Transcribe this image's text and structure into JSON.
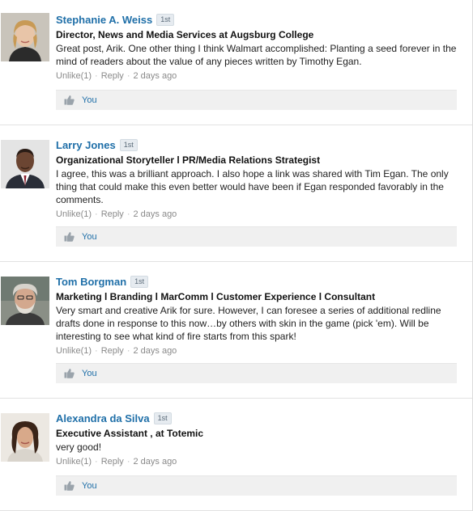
{
  "comments": [
    {
      "name": "Stephanie A. Weiss",
      "degree": "1st",
      "headline": "Director, News and Media Services at Augsburg College",
      "text": "Great post, Arik. One other thing I think Walmart accomplished: Planting a seed forever in the mind of readers about the value of any pieces written by Timothy Egan.",
      "unlike": "Unlike(1)",
      "reply": "Reply",
      "time": "2 days ago",
      "liker": "You"
    },
    {
      "name": "Larry Jones",
      "degree": "1st",
      "headline": "Organizational Storyteller l PR/Media Relations Strategist",
      "text": "I agree, this was a brilliant approach. I also hope a link was shared with Tim Egan. The only thing that could make this even better would have been if Egan responded favorably in the comments.",
      "unlike": "Unlike(1)",
      "reply": "Reply",
      "time": "2 days ago",
      "liker": "You"
    },
    {
      "name": "Tom Borgman",
      "degree": "1st",
      "headline": "Marketing l Branding l MarComm l Customer Experience l Consultant",
      "text": "Very smart and creative Arik for sure. However, I can foresee a series of additional redline drafts done in response to this now…by others with skin in the game (pick 'em). Will be interesting to see what kind of fire starts from this spark!",
      "unlike": "Unlike(1)",
      "reply": "Reply",
      "time": "2 days ago",
      "liker": "You"
    },
    {
      "name": "Alexandra da Silva",
      "degree": "1st",
      "headline": "Executive Assistant , at Totemic",
      "text": "very good!",
      "unlike": "Unlike(1)",
      "reply": "Reply",
      "time": "2 days ago",
      "liker": "You"
    }
  ],
  "icons": {
    "like": "thumbs-up-icon",
    "avatar": "avatar-photo"
  },
  "colors": {
    "name_link": "#1f6fa8",
    "like_bar": "#f0f0f0",
    "meta_text": "#8a8a8a"
  }
}
